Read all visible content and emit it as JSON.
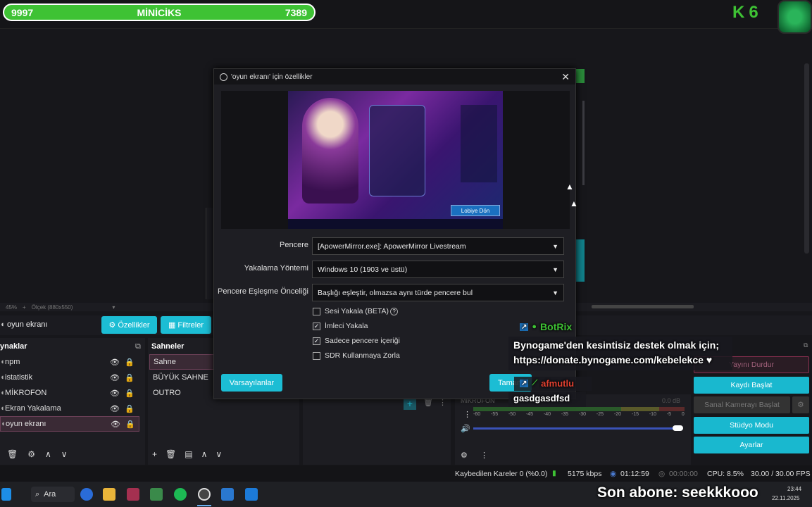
{
  "overlay": {
    "left_count": "9997",
    "title": "MİNİCİKS",
    "right_count": "7389",
    "kick_number": "6",
    "last_sub": "Son abone: seekkkooo"
  },
  "dialog": {
    "title": "'oyun ekranı' için özellikler",
    "preview_button": "Lobiye Dön",
    "fields": [
      {
        "label": "Pencere",
        "value": "[ApowerMirror.exe]: ApowerMirror Livestream"
      },
      {
        "label": "Yakalama Yöntemi",
        "value": "Windows 10 (1903 ve üstü)"
      },
      {
        "label": "Pencere Eşleşme Önceliği",
        "value": "Başlığı eşleştir, olmazsa aynı türde pencere bul"
      }
    ],
    "checks": [
      {
        "label": "Sesi Yakala (BETA)",
        "checked": false
      },
      {
        "label": "İmleci Yakala",
        "checked": true
      },
      {
        "label": "Sadece pencere içeriği",
        "checked": true
      },
      {
        "label": "SDR Kullanmaya Zorla",
        "checked": false
      }
    ],
    "defaults_button": "Varsayılanlar",
    "ok_button": "Tamam"
  },
  "zoombar": {
    "zoom": "45%",
    "scale": "Ölçek (880x550)"
  },
  "source_toolbar": {
    "name": "oyun ekranı",
    "properties": "Özellikler",
    "filters": "Filtreler"
  },
  "sources": {
    "title": "ynaklar",
    "items": [
      "npm",
      "istatistik",
      "MİKROFON",
      "Ekran Yakalama",
      "oyun ekranı"
    ]
  },
  "scenes": {
    "title": "Sahneler",
    "items": [
      "Sahne",
      "BÜYÜK SAHNE",
      "OUTRO"
    ]
  },
  "mixer": {
    "mic_label": "MİKROFON",
    "mic_db": "0.0 dB",
    "ticks": [
      "-60",
      "-55",
      "-50",
      "-45",
      "-40",
      "-35",
      "-30",
      "-25",
      "-20",
      "-15",
      "-10",
      "-5",
      "0"
    ]
  },
  "chat": {
    "bot_name": "BotRix",
    "bot_message": "Bynogame'den kesintisiz destek olmak için; https://donate.bynogame.com/kebelekce ♥",
    "user_name": "afmutlu",
    "user_message": "gasdgasdfsd"
  },
  "controls": {
    "stop_stream": "Yayını Durdur",
    "start_record": "Kaydı Başlat",
    "virtual_cam": "Sanal Kamerayı Başlat",
    "studio_mode": "Stüdyo Modu",
    "settings": "Ayarlar"
  },
  "status": {
    "dropped": "Kaybedilen Kareler 0 (%0.0)",
    "bitrate": "5175 kbps",
    "stream_time": "01:12:59",
    "record_time": "00:00:00",
    "cpu": "CPU: 8.5%",
    "fps": "30.00 / 30.00 FPS"
  },
  "taskbar": {
    "search": "Ara",
    "time": "23:44",
    "date": "22.11.2025"
  },
  "colors": {
    "accent": "#1cbdd4",
    "kick_green": "#3ec234"
  }
}
